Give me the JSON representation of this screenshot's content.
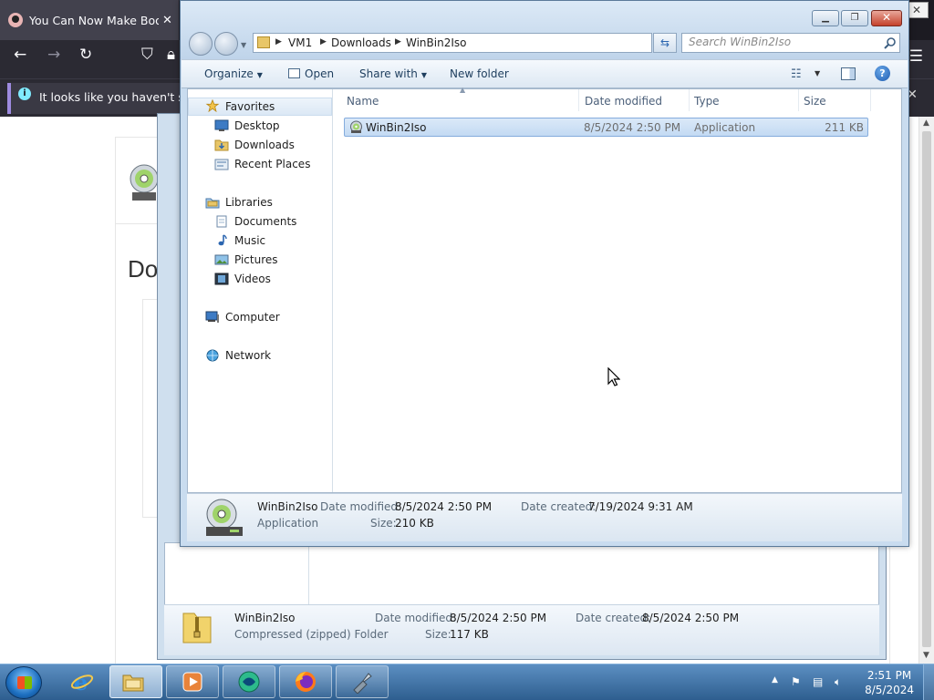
{
  "firefox": {
    "tab_title": "You Can Now Make Bootable",
    "notice_text": "It looks like you haven't started",
    "page_heading": "Dov"
  },
  "explorer": {
    "breadcrumbs": [
      "VM1",
      "Downloads",
      "WinBin2Iso"
    ],
    "search_placeholder": "Search WinBin2Iso",
    "toolbar": {
      "organize": "Organize",
      "open": "Open",
      "share_with": "Share with",
      "new_folder": "New folder"
    },
    "nav": {
      "favorites": "Favorites",
      "desktop": "Desktop",
      "downloads": "Downloads",
      "recent_places": "Recent Places",
      "libraries": "Libraries",
      "documents": "Documents",
      "music": "Music",
      "pictures": "Pictures",
      "videos": "Videos",
      "computer": "Computer",
      "network": "Network"
    },
    "columns": {
      "name": "Name",
      "date_modified": "Date modified",
      "type": "Type",
      "size": "Size"
    },
    "files": [
      {
        "name": "WinBin2Iso",
        "date_modified": "8/5/2024 2:50 PM",
        "type": "Application",
        "size": "211 KB",
        "selected": true
      }
    ],
    "details": {
      "name": "WinBin2Iso",
      "type": "Application",
      "date_modified_label": "Date modified:",
      "date_modified": "8/5/2024 2:50 PM",
      "date_created_label": "Date created:",
      "date_created": "7/19/2024 9:31 AM",
      "size_label": "Size:",
      "size": "210 KB"
    }
  },
  "explorer_back": {
    "details": {
      "name": "WinBin2Iso",
      "type": "Compressed (zipped) Folder",
      "date_modified_label": "Date modified:",
      "date_modified": "8/5/2024 2:50 PM",
      "date_created_label": "Date created:",
      "date_created": "8/5/2024 2:50 PM",
      "size_label": "Size:",
      "size": "117 KB"
    }
  },
  "taskbar": {
    "time": "2:51 PM",
    "date": "8/5/2024",
    "pinned": [
      "internet-explorer-icon",
      "windows-explorer-icon",
      "media-player-icon",
      "green-app-icon",
      "firefox-icon",
      "tool-app-icon"
    ]
  },
  "colors": {
    "accent": "#3399ff",
    "selection": "#c3daf3",
    "firefox_chrome": "#2b2a33"
  }
}
